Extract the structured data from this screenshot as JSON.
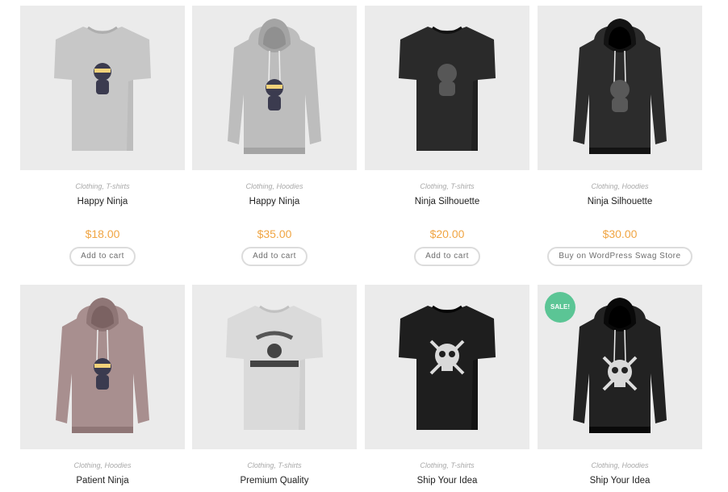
{
  "products": [
    {
      "categories": "Clothing, T-shirts",
      "title": "Happy Ninja",
      "price": "$18.00",
      "button": "Add to cart",
      "shirt_color": "#c7c7c7",
      "kind": "tshirt",
      "print": "ninja"
    },
    {
      "categories": "Clothing, Hoodies",
      "title": "Happy Ninja",
      "price": "$35.00",
      "button": "Add to cart",
      "shirt_color": "#bdbdbd",
      "kind": "hoodie",
      "print": "ninja"
    },
    {
      "categories": "Clothing, T-shirts",
      "title": "Ninja Silhouette",
      "price": "$20.00",
      "button": "Add to cart",
      "shirt_color": "#2a2a2a",
      "kind": "tshirt",
      "print": "silhouette"
    },
    {
      "categories": "Clothing, Hoodies",
      "title": "Ninja Silhouette",
      "price": "$30.00",
      "button": "Buy on WordPress Swag Store",
      "shirt_color": "#2c2c2c",
      "kind": "hoodie",
      "print": "silhouette"
    },
    {
      "categories": "Clothing, Hoodies",
      "title": "Patient Ninja",
      "price": "",
      "button": "",
      "shirt_color": "#a88f8f",
      "kind": "hoodie",
      "print": "ninja"
    },
    {
      "categories": "Clothing, T-shirts",
      "title": "Premium Quality",
      "price": "",
      "button": "",
      "shirt_color": "#dadada",
      "kind": "tshirt",
      "print": "woothemes"
    },
    {
      "categories": "Clothing, T-shirts",
      "title": "Ship Your Idea",
      "price": "",
      "button": "",
      "shirt_color": "#1e1e1e",
      "kind": "tshirt",
      "print": "skull"
    },
    {
      "categories": "Clothing, Hoodies",
      "title": "Ship Your Idea",
      "price": "",
      "button": "",
      "shirt_color": "#222222",
      "kind": "hoodie",
      "print": "skull",
      "badge": "SALE!"
    }
  ],
  "colors": {
    "price": "#f0a543",
    "sale_badge": "#5bc595",
    "thumb_bg": "#ebebeb"
  }
}
